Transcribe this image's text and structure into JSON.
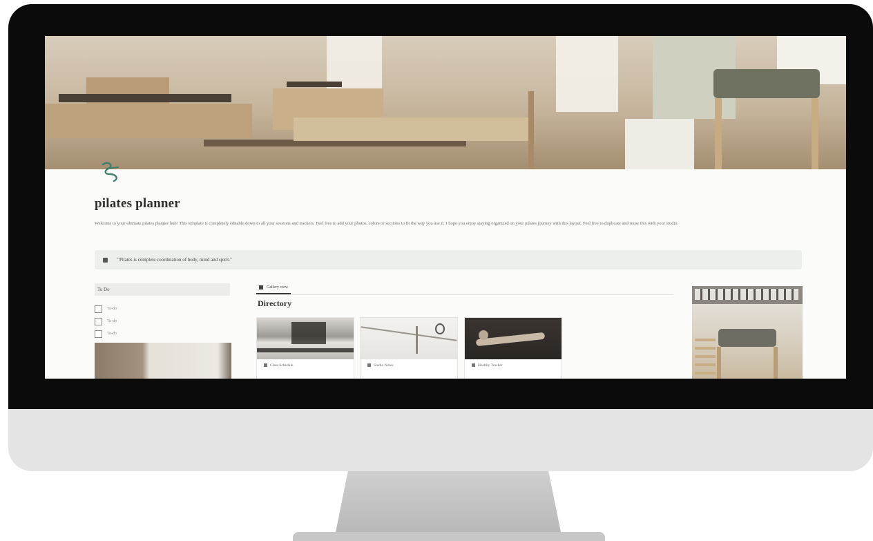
{
  "page": {
    "title": "pilates planner",
    "intro": "Welcome to your ultimate pilates planner hub! This template is completely editable down to all your sessions and trackers. Feel free to add your photos, colors or sections to fit the way you use it. I hope you enjoy staying organized on your pilates journey with this layout. Feel free to duplicate and reuse this with your studio.",
    "callout": "\"Pilates is complete coordination of body, mind and spirit.\""
  },
  "todo": {
    "header": "To Do",
    "items": [
      "To-do",
      "To-do",
      "To-do"
    ]
  },
  "gallery": {
    "view_tab": "Gallery view",
    "title": "Directory",
    "cards": [
      {
        "label": "Class Schedule"
      },
      {
        "label": "Studio Notes"
      },
      {
        "label": "Healthy Tracker"
      }
    ]
  },
  "colors": {
    "accent_icon": "#3f7e6d",
    "callout_bg": "#edefec"
  }
}
